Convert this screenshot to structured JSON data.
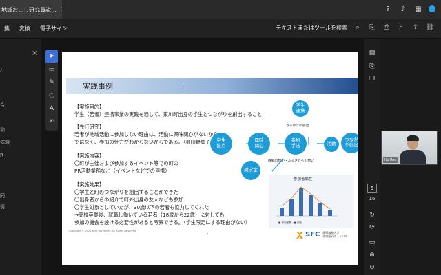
{
  "window": {
    "tab_title": "地域おこし研究員説…",
    "tab_close": "×"
  },
  "menu": {
    "items": [
      "集",
      "変換",
      "電子サイン"
    ],
    "search_hint": "テキストまたはツールを検索"
  },
  "left_panel": {
    "close": "×",
    "fragments": [
      "〉",
      "合",
      "和",
      "体験",
      "R",
      "同",
      "情"
    ]
  },
  "slide": {
    "title": "実践事例",
    "sections": [
      {
        "heading": "【実施目的】",
        "lines": [
          "学生（若者）連携事業の実践を通して、東川町出身の学生とつながりを創出すること"
        ]
      },
      {
        "heading": "【先行研究】",
        "lines": [
          "若者が地域活動に参加しない理由は、活動に興味関心がないから",
          "ではなく、参加の仕方がわからないからである。（羽田野慶子）"
        ]
      },
      {
        "heading": "【実施内容】",
        "lines": [
          "〇町が主催および参加するイベント等での町の",
          "PR活動業務など（イベントなどでの連携）"
        ]
      },
      {
        "heading": "【実施効果】",
        "lines": [
          "〇学生と町のつながりを創出することができた",
          "〇出身者からの紹介で町外出身の友人なども参加",
          "〇学生対象としていたが、30歳以下の若者も協力してくれた",
          "→高校卒業後、就職し働いている若者（18歳から22歳）に対しても",
          "参加の機会を設ける必要性があると考察できる。（学生限定にする理由がない）"
        ]
      }
    ],
    "diagram": {
      "nodes": [
        "学生\n連携",
        "学生\n接点",
        "興味\n関心",
        "参加\n手法",
        "活動",
        "つなが\nり創出",
        "奨学金"
      ],
      "labels": [
        "きっかけの創出",
        "故郷の想い・ふるさとへの想い"
      ]
    },
    "chart": {
      "title": "参加者属性",
      "legend": "■ 参加者数　■ 割合"
    },
    "copyright": "Copyright © 2024 Keio University. All Rights Reserved.",
    "logo_text": "SFC",
    "logo_sub": "慶應義塾大学\n湘南藤沢キャンパス"
  },
  "page_nav": {
    "current": "5",
    "total": "16"
  },
  "video": {
    "name": "Ito Reo"
  }
}
